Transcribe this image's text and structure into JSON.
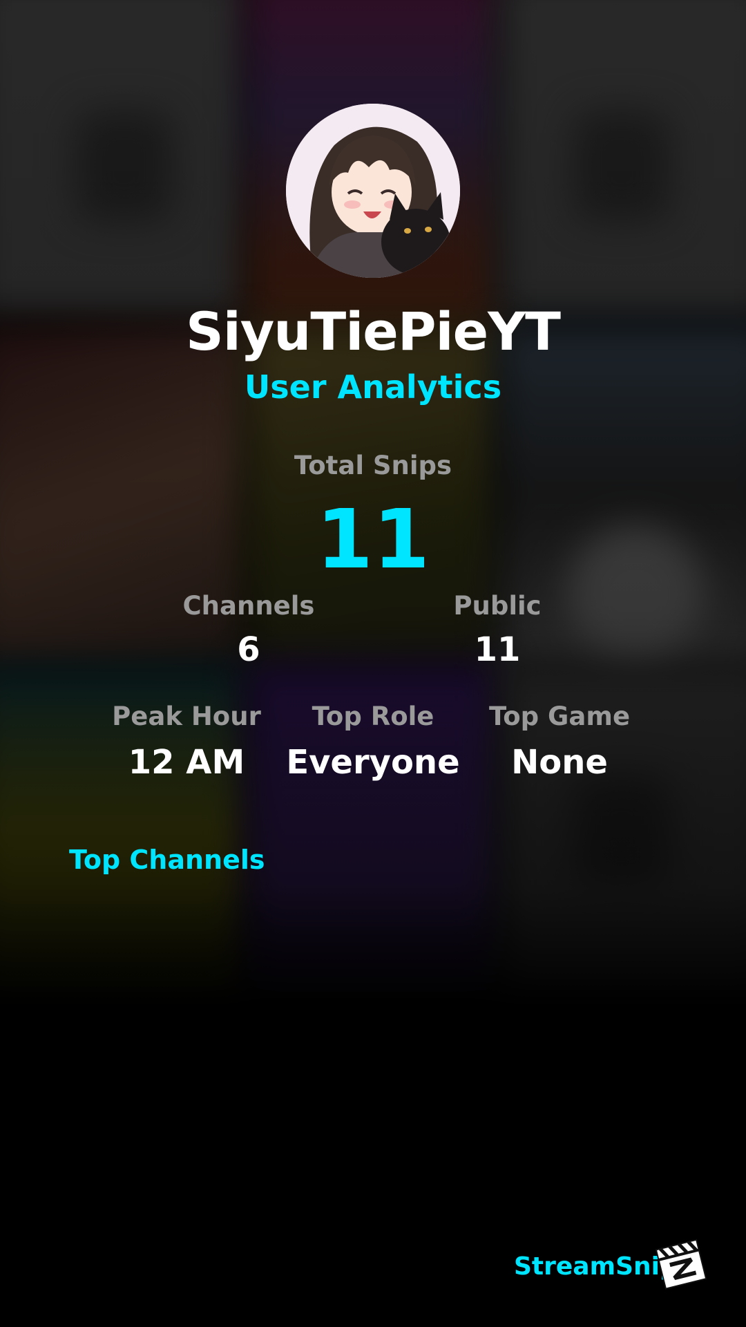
{
  "profile": {
    "username": "SiyuTiePieYT",
    "subtitle": "User Analytics",
    "avatar_icon": "anime-girl-with-black-cat-avatar"
  },
  "stats": {
    "total_snips": {
      "label": "Total Snips",
      "value": "11"
    },
    "channels": {
      "label": "Channels",
      "value": "6"
    },
    "public": {
      "label": "Public",
      "value": "11"
    },
    "peak_hour": {
      "label": "Peak Hour",
      "value": "12 AM"
    },
    "top_role": {
      "label": "Top Role",
      "value": "Everyone"
    },
    "top_game": {
      "label": "Top Game",
      "value": "None"
    }
  },
  "sections": {
    "top_channels_title": "Top Channels"
  },
  "branding": {
    "name": "StreamSnip",
    "logo_icon": "clapperboard-logo-icon"
  },
  "colors": {
    "accent": "#00e5ff",
    "label": "#9a9a9a",
    "value": "#ffffff",
    "background": "#000000"
  }
}
